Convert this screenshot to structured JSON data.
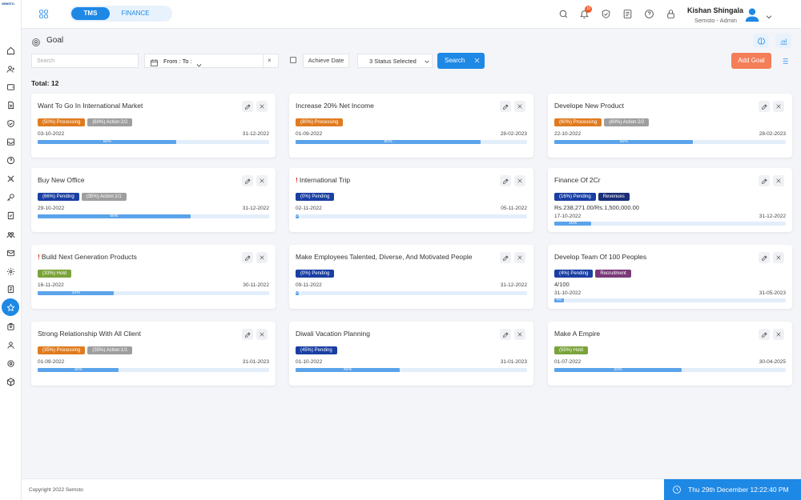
{
  "app": {
    "logo_text": "SEMSTO"
  },
  "tabs": [
    {
      "label": "TMS"
    },
    {
      "label": "FINANCE"
    }
  ],
  "user": {
    "name": "Kishan Shingala",
    "role": "Semsto - Admin"
  },
  "notifications": {
    "count": "10"
  },
  "page": {
    "title": "Goal",
    "total": "Total: 12"
  },
  "filters": {
    "search_placeholder": "Search",
    "date_label": "From : To :",
    "clear": "×",
    "achieve_label": "Achieve Date",
    "status_label": "3 Status Selected",
    "search_button": "Search",
    "add_button": "Add Goal"
  },
  "goals": [
    {
      "title": "Want To Go In International Market",
      "flag": "",
      "badges": [
        {
          "text": "(50%) Processing",
          "type": "processing"
        },
        {
          "text": "(60%) Action:2/2",
          "type": "action"
        }
      ],
      "extra": "",
      "start": "03-10-2022",
      "end": "31-12-2022",
      "progress": 60,
      "progress_label": "60%"
    },
    {
      "title": "Increase 20% Net Income",
      "flag": "",
      "badges": [
        {
          "text": "(80%) Processing",
          "type": "processing"
        }
      ],
      "extra": "",
      "start": "01-09-2022",
      "end": "28-02-2023",
      "progress": 80,
      "progress_label": "80%"
    },
    {
      "title": "Develope New Product",
      "flag": "",
      "badges": [
        {
          "text": "(60%) Processing",
          "type": "processing"
        },
        {
          "text": "(60%) Action:2/2",
          "type": "action"
        }
      ],
      "extra": "",
      "start": "22-10-2022",
      "end": "28-02-2023",
      "progress": 60,
      "progress_label": "60%"
    },
    {
      "title": "Buy New Office",
      "flag": "",
      "badges": [
        {
          "text": "(66%) Pending",
          "type": "pending"
        },
        {
          "text": "(35%) Action:1/1",
          "type": "action"
        }
      ],
      "extra": "",
      "start": "29-10-2022",
      "end": "31-12-2022",
      "progress": 66,
      "progress_label": "66%"
    },
    {
      "title": "International Trip",
      "flag": "!",
      "badges": [
        {
          "text": "(0%) Pending",
          "type": "pending"
        }
      ],
      "extra": "",
      "start": "02-11-2022",
      "end": "05-11-2022",
      "progress": 0,
      "progress_label": "0%"
    },
    {
      "title": "Finance Of 2Cr",
      "flag": "",
      "badges": [
        {
          "text": "(16%) Pending",
          "type": "pending"
        },
        {
          "text": "Revenues",
          "type": "revenues"
        }
      ],
      "extra": "Rs.238,271.00/Rs.1,500,000.00",
      "start": "17-10-2022",
      "end": "31-12-2022",
      "progress": 16,
      "progress_label": "16%"
    },
    {
      "title": "Build Next Generation Products",
      "flag": "!",
      "badges": [
        {
          "text": "(33%) Hold",
          "type": "hold"
        }
      ],
      "extra": "",
      "start": "16-11-2022",
      "end": "30-11-2022",
      "progress": 33,
      "progress_label": "33%"
    },
    {
      "title": "Make Employees Talented, Diverse, And Motivated People",
      "flag": "",
      "badges": [
        {
          "text": "(0%) Pending",
          "type": "pending"
        }
      ],
      "extra": "",
      "start": "09-11-2022",
      "end": "31-12-2022",
      "progress": 0,
      "progress_label": "0%"
    },
    {
      "title": "Develop Team Of 100 Peoples",
      "flag": "",
      "badges": [
        {
          "text": "(4%) Pending",
          "type": "pending"
        },
        {
          "text": "Recruitment",
          "type": "recruitment"
        }
      ],
      "extra": "4/100",
      "start": "31-10-2022",
      "end": "31-05-2023",
      "progress": 4,
      "progress_label": "4%"
    },
    {
      "title": "Strong Relationship With All Client",
      "flag": "",
      "badges": [
        {
          "text": "(35%) Processing",
          "type": "processing"
        },
        {
          "text": "(35%) Action:1/1",
          "type": "action"
        }
      ],
      "extra": "",
      "start": "01-09-2022",
      "end": "31-01-2023",
      "progress": 35,
      "progress_label": "35%"
    },
    {
      "title": "Diwali Vacation Planning",
      "flag": "",
      "badges": [
        {
          "text": "(45%) Pending",
          "type": "pending"
        }
      ],
      "extra": "",
      "start": "01-10-2022",
      "end": "31-01-2023",
      "progress": 45,
      "progress_label": "45%"
    },
    {
      "title": "Make A Empire",
      "flag": "",
      "badges": [
        {
          "text": "(55%) Hold",
          "type": "hold"
        }
      ],
      "extra": "",
      "start": "01-07-2022",
      "end": "30-04-2025",
      "progress": 55,
      "progress_label": "55%"
    }
  ],
  "footer": {
    "copyright": "Copyright 2022 Semsto",
    "datetime": "Thu 29th December 12:22:40 PM"
  },
  "colors": {
    "accent": "#1e88e5",
    "processing": "#e07b1f",
    "pending": "#1a3fa3",
    "hold": "#7aa33a",
    "action": "#9e9e9e",
    "add_button": "#f37e58"
  }
}
